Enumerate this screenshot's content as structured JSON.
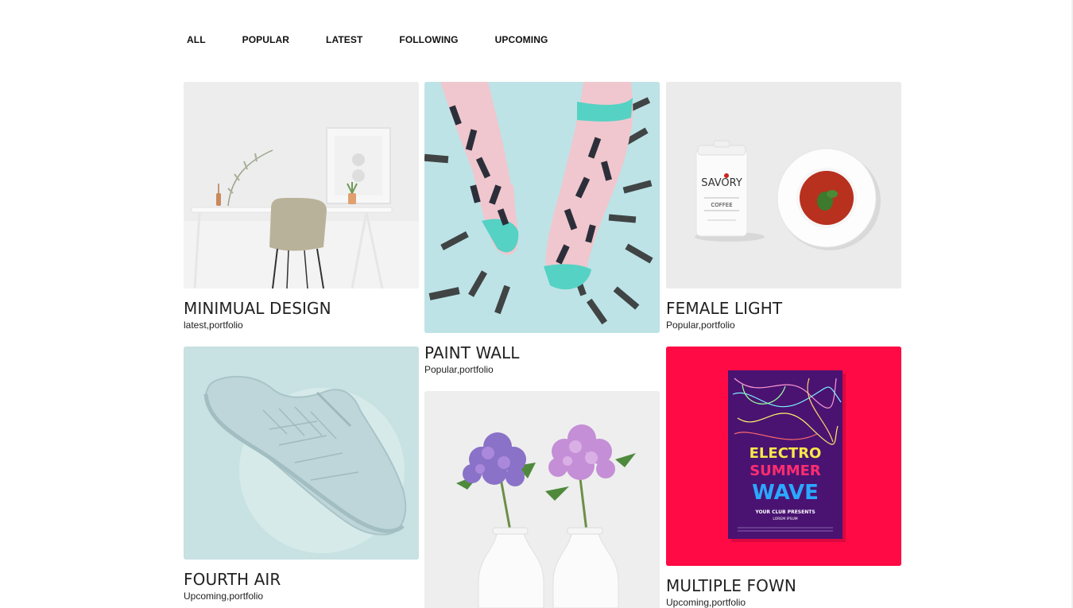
{
  "filters": [
    "ALL",
    "POPULAR",
    "LATEST",
    "FOLLOWING",
    "UPCOMING"
  ],
  "cards": [
    {
      "title": "MINIMUAL DESIGN",
      "tags": "latest,portfolio"
    },
    {
      "title": "PAINT WALL",
      "tags": "Popular,portfolio"
    },
    {
      "title": "FEMALE LIGHT",
      "tags": "Popular,portfolio"
    },
    {
      "title": "FOURTH AIR",
      "tags": "Upcoming,portfolio"
    },
    {
      "title": "",
      "tags": ""
    },
    {
      "title": "MULTIPLE FOWN",
      "tags": "Upcoming,portfolio"
    }
  ],
  "images": {
    "savory_brand": "SAVORY",
    "savory_label": "COFFEE",
    "poster_line1": "ELECTRO",
    "poster_line2": "SUMMER",
    "poster_line3": "WAVE",
    "poster_sub1": "YOUR CLUB PRESENTS",
    "poster_sub2": "LOREM IPSUM"
  },
  "colors": {
    "accent_red": "#ff0a45",
    "socks_bg": "#b9e2e6",
    "shoe_bg": "#c7e1e2"
  }
}
